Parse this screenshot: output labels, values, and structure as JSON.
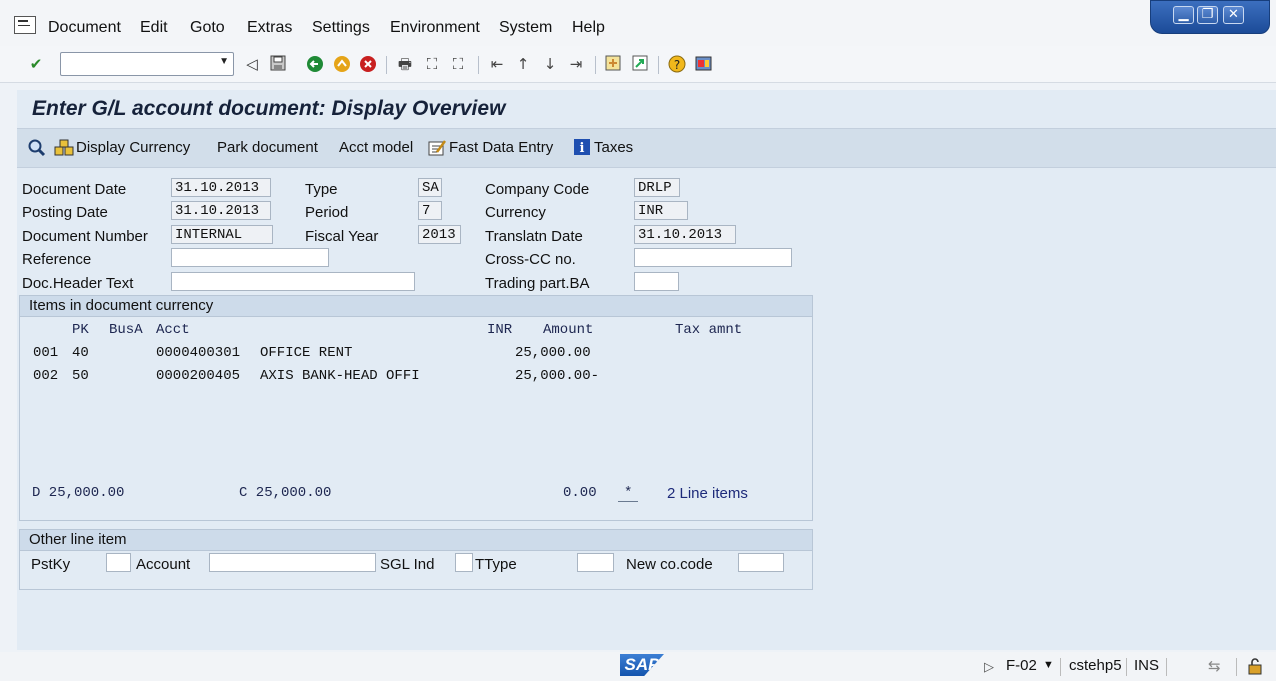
{
  "menu": {
    "document": "Document",
    "edit": "Edit",
    "goto": "Goto",
    "extras": "Extras",
    "settings": "Settings",
    "environment": "Environment",
    "system": "System",
    "help": "Help"
  },
  "window_controls": {
    "minimize": "▁",
    "restore": "❐",
    "close": "✕"
  },
  "toolbar": {
    "command_value": "",
    "icons": [
      "enter-icon",
      "back-icon",
      "save-icon",
      "back-green-icon",
      "exit-icon",
      "cancel-icon",
      "print-icon",
      "find-icon",
      "find-next-icon",
      "first-page-icon",
      "prev-page-icon",
      "next-page-icon",
      "last-page-icon",
      "new-session-icon",
      "shortcut-icon",
      "help-icon",
      "customize-layout-icon"
    ]
  },
  "page": {
    "title": "Enter G/L account document: Display Overview"
  },
  "app_toolbar": {
    "display_currency": "Display Currency",
    "park_document": "Park document",
    "acct_model": "Acct model",
    "fast_data_entry": "Fast Data Entry",
    "taxes": "Taxes"
  },
  "header": {
    "document_date_label": "Document Date",
    "document_date": "31.10.2013",
    "posting_date_label": "Posting Date",
    "posting_date": "31.10.2013",
    "document_number_label": "Document Number",
    "document_number": "INTERNAL",
    "reference_label": "Reference",
    "reference": "",
    "doc_header_text_label": "Doc.Header Text",
    "doc_header_text": "",
    "type_label": "Type",
    "type": "SA",
    "period_label": "Period",
    "period": "7",
    "fiscal_year_label": "Fiscal Year",
    "fiscal_year": "2013",
    "company_code_label": "Company Code",
    "company_code": "DRLP",
    "currency_label": "Currency",
    "currency": "INR",
    "translatn_date_label": "Translatn Date",
    "translatn_date": "31.10.2013",
    "cross_cc_label": "Cross-CC no.",
    "cross_cc": "",
    "trading_part_label": "Trading part.BA",
    "trading_part": ""
  },
  "items": {
    "title": "Items in document currency",
    "columns": {
      "pk": "PK",
      "busa": "BusA",
      "acct": "Acct",
      "currency": "INR",
      "amount": "Amount",
      "tax_amnt": "Tax amnt"
    },
    "rows": [
      {
        "no": "001",
        "pk": "40",
        "acct": "0000400301",
        "name": "OFFICE RENT",
        "amount": "25,000.00"
      },
      {
        "no": "002",
        "pk": "50",
        "acct": "0000200405",
        "name": "AXIS BANK-HEAD OFFI",
        "amount": "25,000.00-"
      }
    ],
    "debit_total": "D 25,000.00",
    "credit_total": "C 25,000.00",
    "balance": "0.00",
    "balance_marker": "*",
    "line_items": "2 Line items"
  },
  "other_line_item": {
    "title": "Other line item",
    "pstky_label": "PstKy",
    "pstky": "",
    "account_label": "Account",
    "account": "",
    "sgl_ind_label": "SGL Ind",
    "sgl_ind": "",
    "ttype_label": "TType",
    "ttype": "",
    "new_co_code_label": "New co.code",
    "new_co_code": ""
  },
  "status": {
    "logo": "SAP",
    "transaction": "F-02",
    "server": "cstehp5",
    "mode": "INS"
  }
}
